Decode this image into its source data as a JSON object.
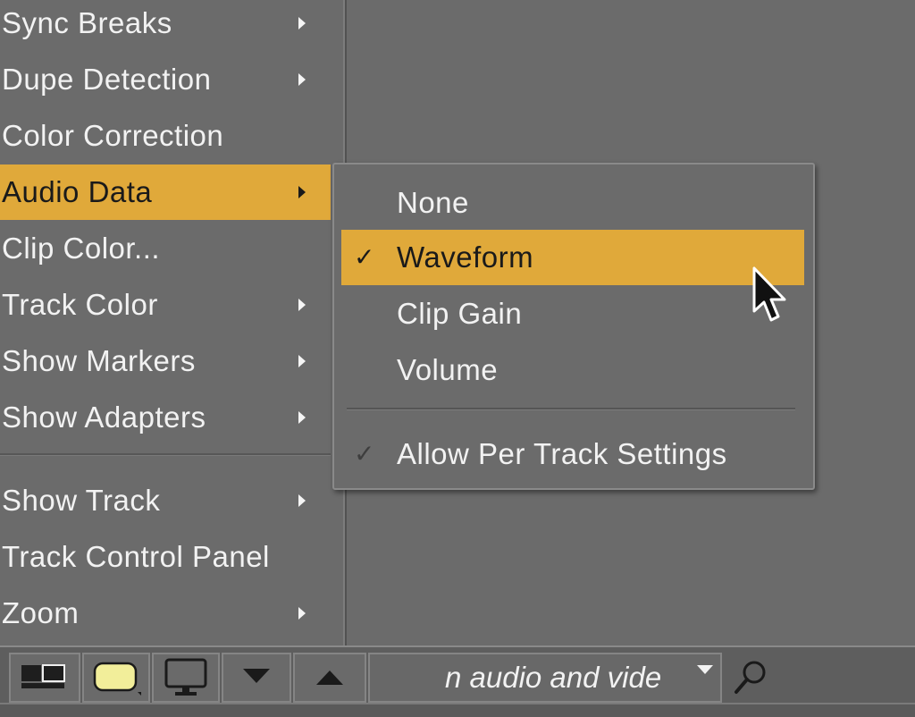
{
  "left_menu": {
    "items": [
      {
        "label": "Sync Breaks",
        "submenu": true
      },
      {
        "label": "Dupe Detection",
        "submenu": true
      },
      {
        "label": "Color Correction",
        "submenu": false
      },
      {
        "label": "Audio Data",
        "submenu": true,
        "highlighted": true
      },
      {
        "label": "Clip Color...",
        "submenu": false
      },
      {
        "label": "Track Color",
        "submenu": true
      },
      {
        "label": "Show Markers",
        "submenu": true
      },
      {
        "label": "Show Adapters",
        "submenu": true
      },
      {
        "label": "Show Track",
        "submenu": true
      },
      {
        "label": "Track Control Panel",
        "submenu": false
      },
      {
        "label": "Zoom",
        "submenu": true
      }
    ]
  },
  "submenu": {
    "items": [
      {
        "label": "None",
        "checked": false
      },
      {
        "label": "Waveform",
        "checked": true,
        "highlighted": true
      },
      {
        "label": "Clip Gain",
        "checked": false
      },
      {
        "label": "Volume",
        "checked": false
      },
      {
        "label": "Allow Per Track Settings",
        "checked": true,
        "dimmed_check": true
      }
    ],
    "checkmark": "✓"
  },
  "toolbar": {
    "search_text": "n audio and vide"
  },
  "colors": {
    "highlight": "#e0a93a",
    "background": "#6b6b6b",
    "swatch": "#f2ee9a"
  },
  "icons": [
    "monitor-layout-icon",
    "clip-color-swatch-icon",
    "display-icon",
    "down-arrow-icon",
    "up-arrow-icon",
    "search-icon",
    "mouse-cursor-icon"
  ]
}
